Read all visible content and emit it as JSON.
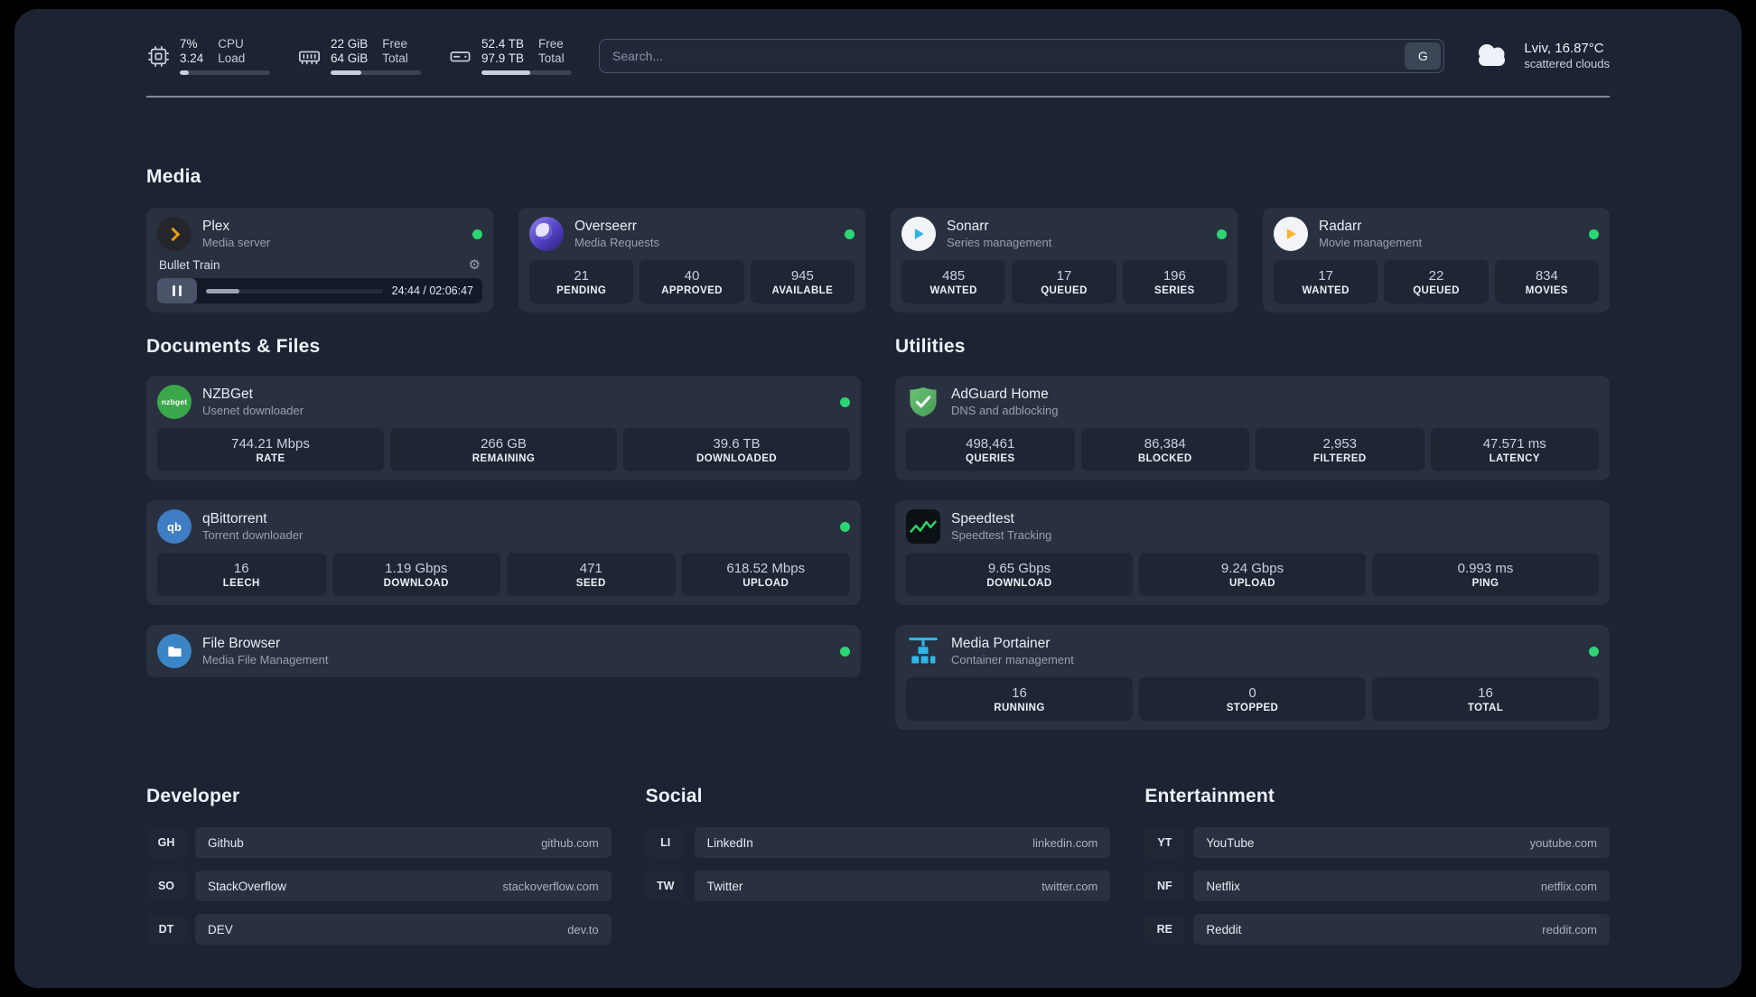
{
  "colors": {
    "status_online": "#2cd673"
  },
  "header": {
    "cpu": {
      "icon": "cpu-chip",
      "value_top": "7%",
      "value_bottom": "3.24",
      "label_top": "CPU",
      "label_bottom": "Load",
      "progress_pct": 10
    },
    "ram": {
      "icon": "memory",
      "value_top": "22 GiB",
      "value_bottom": "64 GiB",
      "label_top": "Free",
      "label_bottom": "Total",
      "progress_pct": 34
    },
    "disk": {
      "icon": "hard-drive",
      "value_top": "52.4 TB",
      "value_bottom": "97.9 TB",
      "label_top": "Free",
      "label_bottom": "Total",
      "progress_pct": 54
    },
    "search": {
      "placeholder": "Search...",
      "provider_label": "G"
    },
    "weather": {
      "icon": "cloud",
      "location": "Lviv, 16.87°C",
      "condition": "scattered clouds"
    }
  },
  "media": {
    "title": "Media",
    "plex": {
      "name": "Plex",
      "subtitle": "Media server",
      "online": true,
      "now_playing": {
        "title": "Bullet Train",
        "time": "24:44 / 02:06:47",
        "progress_pct": 19
      }
    },
    "overseerr": {
      "name": "Overseerr",
      "subtitle": "Media Requests",
      "online": true,
      "stats": [
        {
          "value": "21",
          "label": "PENDING"
        },
        {
          "value": "40",
          "label": "APPROVED"
        },
        {
          "value": "945",
          "label": "AVAILABLE"
        }
      ]
    },
    "sonarr": {
      "name": "Sonarr",
      "subtitle": "Series management",
      "online": true,
      "stats": [
        {
          "value": "485",
          "label": "WANTED"
        },
        {
          "value": "17",
          "label": "QUEUED"
        },
        {
          "value": "196",
          "label": "SERIES"
        }
      ]
    },
    "radarr": {
      "name": "Radarr",
      "subtitle": "Movie management",
      "online": true,
      "stats": [
        {
          "value": "17",
          "label": "WANTED"
        },
        {
          "value": "22",
          "label": "QUEUED"
        },
        {
          "value": "834",
          "label": "MOVIES"
        }
      ]
    }
  },
  "documents": {
    "title": "Documents & Files",
    "nzbget": {
      "name": "NZBGet",
      "subtitle": "Usenet downloader",
      "icon_text": "nzbget",
      "online": true,
      "stats": [
        {
          "value": "744.21 Mbps",
          "label": "RATE"
        },
        {
          "value": "266 GB",
          "label": "REMAINING"
        },
        {
          "value": "39.6 TB",
          "label": "DOWNLOADED"
        }
      ]
    },
    "qbittorrent": {
      "name": "qBittorrent",
      "subtitle": "Torrent downloader",
      "icon_text": "qb",
      "online": true,
      "stats": [
        {
          "value": "16",
          "label": "LEECH"
        },
        {
          "value": "1.19 Gbps",
          "label": "DOWNLOAD"
        },
        {
          "value": "471",
          "label": "SEED"
        },
        {
          "value": "618.52 Mbps",
          "label": "UPLOAD"
        }
      ]
    },
    "filebrowser": {
      "name": "File Browser",
      "subtitle": "Media File Management",
      "online": true
    }
  },
  "utilities": {
    "title": "Utilities",
    "adguard": {
      "name": "AdGuard Home",
      "subtitle": "DNS and adblocking",
      "stats": [
        {
          "value": "498,461",
          "label": "QUERIES"
        },
        {
          "value": "86,384",
          "label": "BLOCKED"
        },
        {
          "value": "2,953",
          "label": "FILTERED"
        },
        {
          "value": "47.571 ms",
          "label": "LATENCY"
        }
      ]
    },
    "speedtest": {
      "name": "Speedtest",
      "subtitle": "Speedtest Tracking",
      "stats": [
        {
          "value": "9.65 Gbps",
          "label": "DOWNLOAD"
        },
        {
          "value": "9.24 Gbps",
          "label": "UPLOAD"
        },
        {
          "value": "0.993 ms",
          "label": "PING"
        }
      ]
    },
    "portainer": {
      "name": "Media Portainer",
      "subtitle": "Container management",
      "online": true,
      "stats": [
        {
          "value": "16",
          "label": "RUNNING"
        },
        {
          "value": "0",
          "label": "STOPPED"
        },
        {
          "value": "16",
          "label": "TOTAL"
        }
      ]
    }
  },
  "bookmarks": {
    "developer": {
      "title": "Developer",
      "items": [
        {
          "abbr": "GH",
          "name": "Github",
          "url": "github.com"
        },
        {
          "abbr": "SO",
          "name": "StackOverflow",
          "url": "stackoverflow.com"
        },
        {
          "abbr": "DT",
          "name": "DEV",
          "url": "dev.to"
        }
      ]
    },
    "social": {
      "title": "Social",
      "items": [
        {
          "abbr": "LI",
          "name": "LinkedIn",
          "url": "linkedin.com"
        },
        {
          "abbr": "TW",
          "name": "Twitter",
          "url": "twitter.com"
        }
      ]
    },
    "entertainment": {
      "title": "Entertainment",
      "items": [
        {
          "abbr": "YT",
          "name": "YouTube",
          "url": "youtube.com"
        },
        {
          "abbr": "NF",
          "name": "Netflix",
          "url": "netflix.com"
        },
        {
          "abbr": "RE",
          "name": "Reddit",
          "url": "reddit.com"
        }
      ]
    }
  }
}
